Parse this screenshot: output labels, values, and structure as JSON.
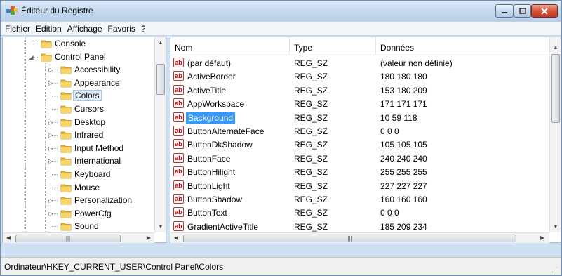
{
  "window": {
    "title": "Éditeur du Registre"
  },
  "menubar": [
    "Fichier",
    "Edition",
    "Affichage",
    "Favoris",
    "?"
  ],
  "tree": {
    "items": [
      {
        "label": "Console",
        "expander": "",
        "selected": false
      },
      {
        "label": "Control Panel",
        "expander": "◢",
        "selected": false
      },
      {
        "label": "Accessibility",
        "expander": "▷",
        "selected": false
      },
      {
        "label": "Appearance",
        "expander": "▷",
        "selected": false
      },
      {
        "label": "Colors",
        "expander": "",
        "selected": true
      },
      {
        "label": "Cursors",
        "expander": "",
        "selected": false
      },
      {
        "label": "Desktop",
        "expander": "▷",
        "selected": false
      },
      {
        "label": "Infrared",
        "expander": "▷",
        "selected": false
      },
      {
        "label": "Input Method",
        "expander": "▷",
        "selected": false
      },
      {
        "label": "International",
        "expander": "▷",
        "selected": false
      },
      {
        "label": "Keyboard",
        "expander": "",
        "selected": false
      },
      {
        "label": "Mouse",
        "expander": "",
        "selected": false
      },
      {
        "label": "Personalization",
        "expander": "▷",
        "selected": false
      },
      {
        "label": "PowerCfg",
        "expander": "▷",
        "selected": false
      },
      {
        "label": "Sound",
        "expander": "",
        "selected": false
      }
    ]
  },
  "values": {
    "columns": {
      "name": "Nom",
      "type": "Type",
      "data": "Données"
    },
    "rows": [
      {
        "name": "(par défaut)",
        "type": "REG_SZ",
        "data": "(valeur non définie)",
        "selected": false
      },
      {
        "name": "ActiveBorder",
        "type": "REG_SZ",
        "data": "180 180 180",
        "selected": false
      },
      {
        "name": "ActiveTitle",
        "type": "REG_SZ",
        "data": "153 180 209",
        "selected": false
      },
      {
        "name": "AppWorkspace",
        "type": "REG_SZ",
        "data": "171 171 171",
        "selected": false
      },
      {
        "name": "Background",
        "type": "REG_SZ",
        "data": "10 59 118",
        "selected": true
      },
      {
        "name": "ButtonAlternateFace",
        "type": "REG_SZ",
        "data": "0 0 0",
        "selected": false
      },
      {
        "name": "ButtonDkShadow",
        "type": "REG_SZ",
        "data": "105 105 105",
        "selected": false
      },
      {
        "name": "ButtonFace",
        "type": "REG_SZ",
        "data": "240 240 240",
        "selected": false
      },
      {
        "name": "ButtonHilight",
        "type": "REG_SZ",
        "data": "255 255 255",
        "selected": false
      },
      {
        "name": "ButtonLight",
        "type": "REG_SZ",
        "data": "227 227 227",
        "selected": false
      },
      {
        "name": "ButtonShadow",
        "type": "REG_SZ",
        "data": "160 160 160",
        "selected": false
      },
      {
        "name": "ButtonText",
        "type": "REG_SZ",
        "data": "0 0 0",
        "selected": false
      },
      {
        "name": "GradientActiveTitle",
        "type": "REG_SZ",
        "data": "185 209 234",
        "selected": false
      }
    ]
  },
  "statusbar": {
    "path": "Ordinateur\\HKEY_CURRENT_USER\\Control Panel\\Colors"
  },
  "icons": {
    "value_string": "string-value-icon",
    "folder": "folder-icon",
    "app": "registry-editor-icon"
  },
  "colors": {
    "selection": "#3399ff",
    "folder": "#e8b93c",
    "title_bar": "#c5d8ef"
  }
}
